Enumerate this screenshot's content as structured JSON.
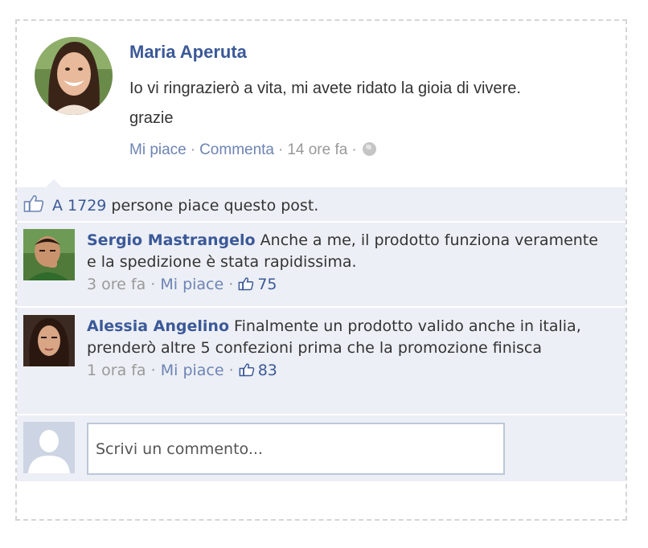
{
  "post": {
    "author": "Maria Aperuta",
    "text": "Io vi ringrazierò a vita, mi avete ridato la gioia di vivere. grazie",
    "like_label": "Mi piace",
    "comment_label": "Commenta",
    "time": "14 ore fa"
  },
  "likes": {
    "prefix": "A 1729",
    "suffix": " persone piace questo post."
  },
  "comments": [
    {
      "author": "Sergio Mastrangelo",
      "text": " Anche a me, il prodotto funziona veramente e la spedizione è stata rapidissima.",
      "time": "3 ore fa",
      "like_label": "Mi piace",
      "like_count": "75"
    },
    {
      "author": "Alessia Angelino",
      "text": " Finalmente un prodotto valido anche in italia, prenderò altre 5 confezioni prima che la promozione finisca",
      "time": "1 ora fa",
      "like_label": "Mi piace",
      "like_count": "83"
    }
  ],
  "reply": {
    "placeholder": "Scrivi un commento..."
  },
  "icons": {
    "globe": "globe-icon",
    "thumb": "thumbs-up-icon"
  },
  "colors": {
    "link": "#3b5998",
    "feedback_bg": "#eceff5",
    "muted": "#999999"
  }
}
